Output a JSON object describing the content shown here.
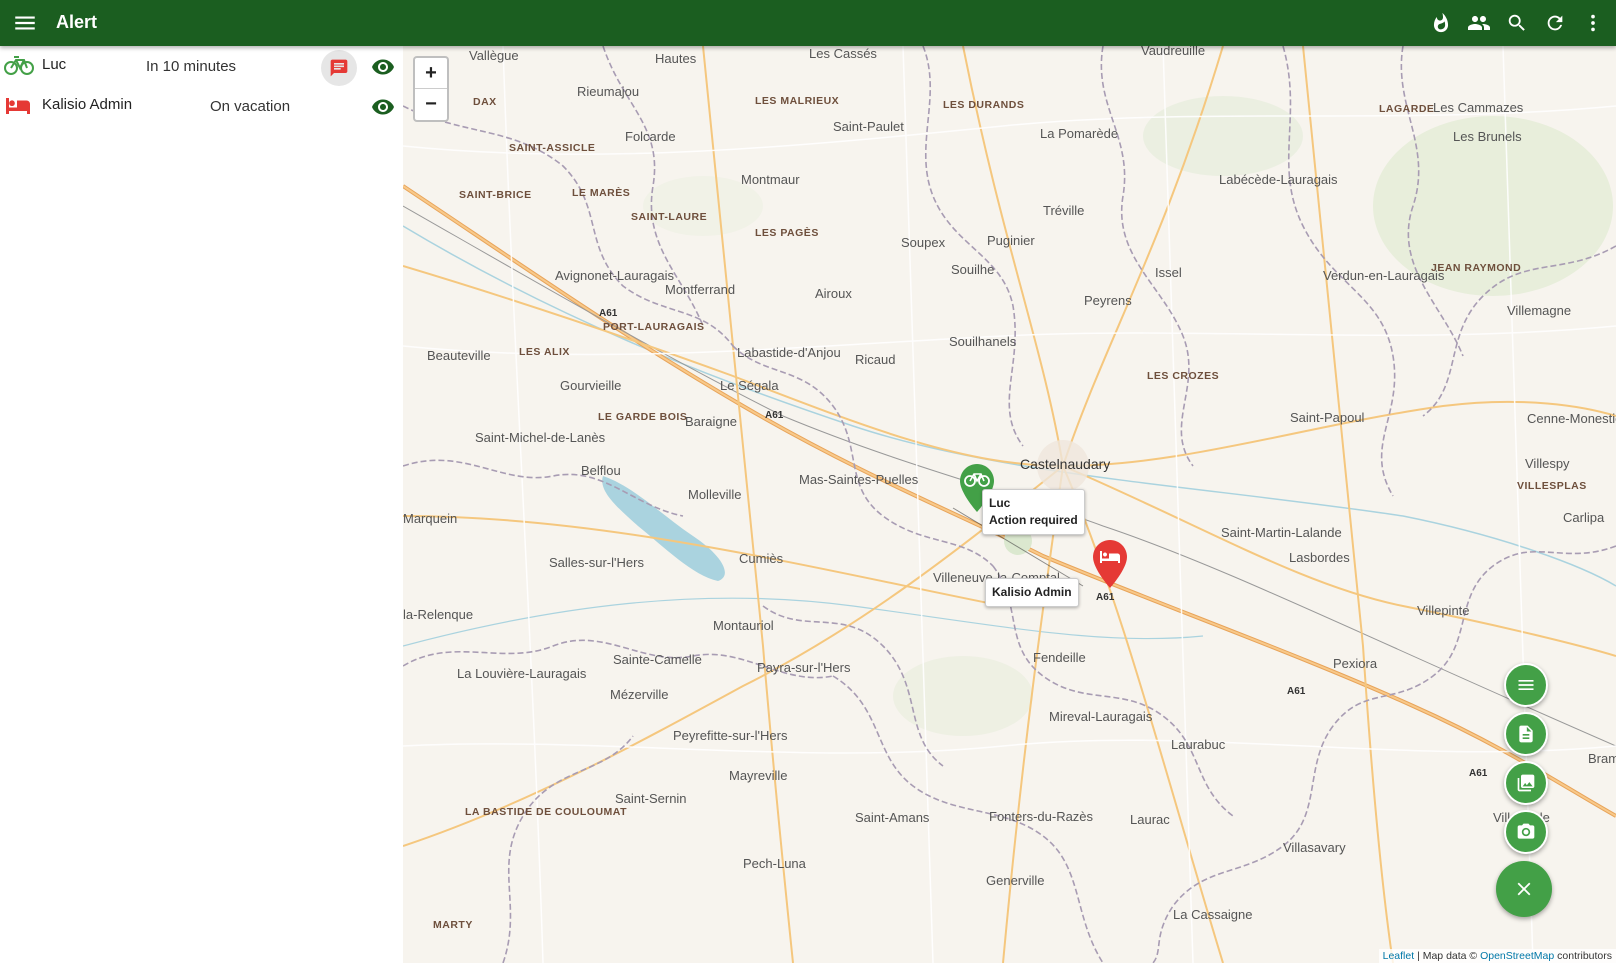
{
  "app_bar": {
    "title": "Alert",
    "icons": [
      "menu-icon",
      "fire-icon",
      "people-icon",
      "search-icon",
      "refresh-icon",
      "more-vert-icon"
    ]
  },
  "members": [
    {
      "name": "Luc",
      "status": "In 10 minutes",
      "icon": "bike-icon",
      "color": "#43a047"
    },
    {
      "name": "Kalisio Admin",
      "status": "On vacation",
      "icon": "bed-icon",
      "color": "#e53935"
    }
  ],
  "map": {
    "zoom_in": "+",
    "zoom_out": "−",
    "places": [
      "Vallègue",
      "Hautes",
      "Les Cassés",
      "Vaudreuille",
      "Rieumajou",
      "DAX",
      "LES MALRIEUX",
      "LES DURANDS",
      "Saint-Paulet",
      "La Pomarède",
      "LAGARDE",
      "Les Cammazes",
      "Folcarde",
      "SAINT-ASSICLE",
      "Les Brunels",
      "Montmaur",
      "SAINT-BRICE",
      "LE MARÈS",
      "Labécède-Lauragais",
      "Tréville",
      "SAINT-LAURE",
      "LES PAGÈS",
      "Soupex",
      "Puginier",
      "Avignonet-Lauragais",
      "Souilhe",
      "Issel",
      "Verdun-en-Lauragais",
      "JEAN RAYMOND",
      "Montferrand",
      "Airoux",
      "Peyrens",
      "Villemagne",
      "PORT-LAURAGAIS",
      "LES ALIX",
      "Beauteville",
      "Labastide-d'Anjou",
      "Souilhanels",
      "Ricaud",
      "Gourvieille",
      "Le Ségala",
      "LES CROZES",
      "LE GARDE BOIS",
      "Baraigne",
      "Saint-Papoul",
      "Cenne-Monestiés",
      "Saint-Michel-de-Lanès",
      "Belflou",
      "Castelnaudary",
      "Villespy",
      "VILLESPLAS",
      "Mas-Saintes-Puelles",
      "Molleville",
      "Marquein",
      "Carlipa",
      "Saint-Martin-Lalande",
      "Lasbordes",
      "Cumiès",
      "Salles-sur-l'Hers",
      "Villeneuve-la-Comptal",
      "Villepinte",
      "la-Relenque",
      "Montauriol",
      "Fendeille",
      "Pexiora",
      "Sainte-Camelle",
      "La Louvière-Lauragais",
      "Payra-sur-l'Hers",
      "Mézerville",
      "Mireval-Lauragais",
      "Laurabuc",
      "Peyrefitte-sur-l'Hers",
      "Bram",
      "Mayreville",
      "Saint-Sernin",
      "LA BASTIDE DE COULOUMAT",
      "Saint-Amans",
      "Fonters-du-Razès",
      "Lauraс",
      "Villesiscle",
      "Villasavary",
      "Pech-Luna",
      "Generville",
      "La Cassaigne",
      "MARTY"
    ],
    "roads": [
      "A61",
      "A61",
      "A61",
      "A61",
      "A61"
    ],
    "tooltips": [
      {
        "line1": "Luc",
        "line2": "Action required"
      },
      {
        "line1": "Kalisio Admin"
      }
    ],
    "attribution": {
      "leaflet": "Leaflet",
      "sep": "| Map data ©",
      "osm": "OpenStreetMap",
      "suffix": "contributors"
    }
  },
  "fabs": [
    "list-icon",
    "document-icon",
    "image-icon",
    "camera-icon",
    "close-icon"
  ]
}
